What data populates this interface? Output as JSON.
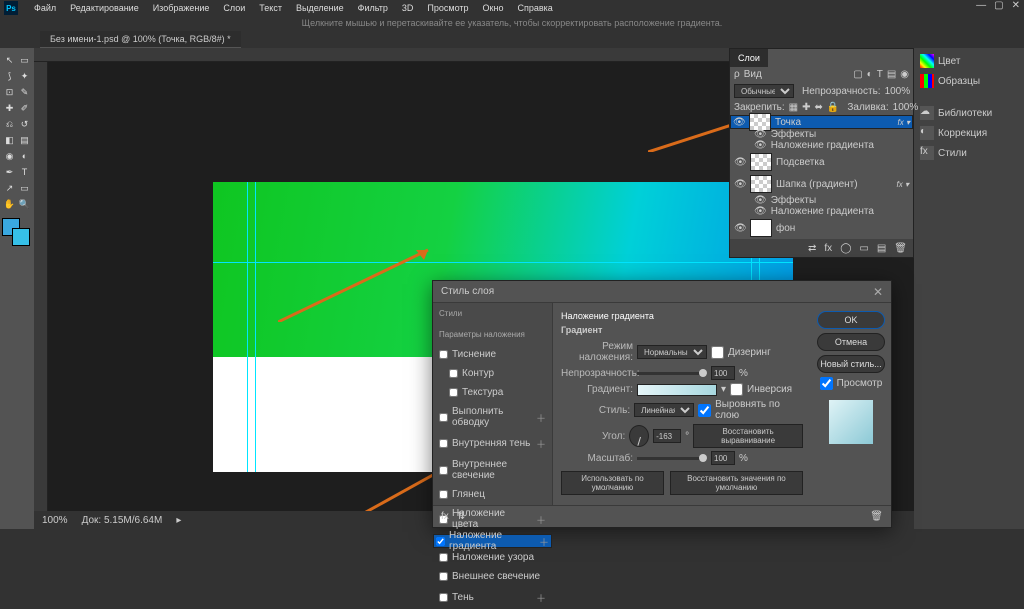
{
  "app": {
    "logo": "Ps"
  },
  "menu": [
    "Файл",
    "Редактирование",
    "Изображение",
    "Слои",
    "Текст",
    "Выделение",
    "Фильтр",
    "3D",
    "Просмотр",
    "Окно",
    "Справка"
  ],
  "hint": "Щелкните мышью и перетаскивайте ее указатель, чтобы скорректировать расположение градиента.",
  "tab": "Без имени-1.psd @ 100% (Точка, RGB/8#) *",
  "status": {
    "zoom": "100%",
    "doc": "Док: 5.15M/6.64M"
  },
  "dock": {
    "items": [
      "Цвет",
      "Образцы",
      "Библиотеки",
      "Коррекция",
      "Стили"
    ]
  },
  "layers_panel": {
    "title": "Слои",
    "filter_label": "Вид",
    "mode": "Обычные",
    "opacity_label": "Непрозрачность:",
    "opacity": "100%",
    "lock_label": "Закрепить:",
    "fill_label": "Заливка:",
    "fill": "100%",
    "layers": [
      {
        "name": "Точка",
        "fx": true,
        "selected": true
      },
      {
        "name": "Подсветка"
      },
      {
        "name": "Шапка (градиент)",
        "fx": true
      },
      {
        "name": "фон"
      }
    ],
    "effects": "Эффекты",
    "grad_overlay": "Наложение градиента"
  },
  "dialog": {
    "title": "Стиль слоя",
    "left_header": "Стили",
    "params_header": "Параметры наложения",
    "cats": [
      {
        "label": "Тиснение"
      },
      {
        "label": "Контур",
        "sub": true
      },
      {
        "label": "Текстура",
        "sub": true
      },
      {
        "label": "Выполнить обводку",
        "plus": true
      },
      {
        "label": "Внутренняя тень",
        "plus": true
      },
      {
        "label": "Внутреннее свечение"
      },
      {
        "label": "Глянец"
      },
      {
        "label": "Наложение цвета",
        "plus": true
      },
      {
        "label": "Наложение градиента",
        "plus": true,
        "checked": true,
        "selected": true
      },
      {
        "label": "Наложение узора"
      },
      {
        "label": "Внешнее свечение"
      },
      {
        "label": "Тень",
        "plus": true
      }
    ],
    "section_title": "Наложение градиента",
    "subsection": "Градиент",
    "mode_label": "Режим наложения:",
    "mode": "Нормальный",
    "dither": "Дизеринг",
    "opacity_label": "Непрозрачность:",
    "opacity": "100",
    "pct": "%",
    "gradient_label": "Градиент:",
    "reverse": "Инверсия",
    "style_label": "Стиль:",
    "style": "Линейная",
    "align": "Выровнять по слою",
    "angle_label": "Угол:",
    "angle": "-163",
    "reset_align": "Восстановить выравнивание",
    "scale_label": "Масштаб:",
    "scale": "100",
    "make_default": "Использовать по умолчанию",
    "reset_default": "Восстановить значения по умолчанию",
    "ok": "OK",
    "cancel": "Отмена",
    "new_style": "Новый стиль...",
    "preview": "Просмотр"
  }
}
